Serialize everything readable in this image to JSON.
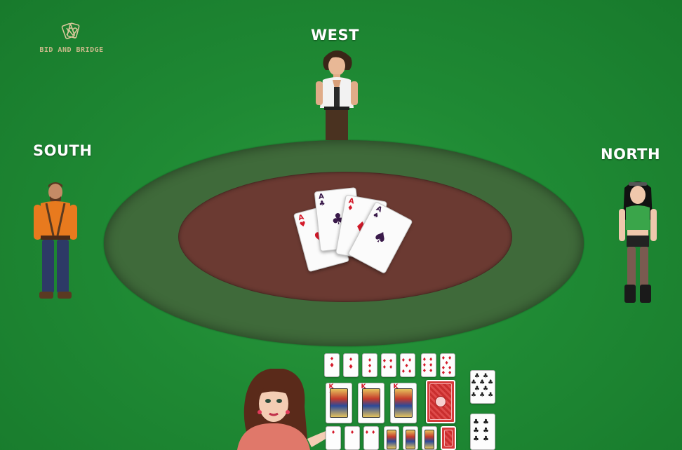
{
  "logo": {
    "text": "BID AND BRIDGE"
  },
  "seats": {
    "west": "WEST",
    "south": "SOUTH",
    "north": "NORTH"
  },
  "trick": [
    {
      "rank": "A",
      "suit": "hearts",
      "glyph": "♥",
      "color": "#d41a2a"
    },
    {
      "rank": "A",
      "suit": "clubs",
      "glyph": "♣",
      "color": "#3a1a4a"
    },
    {
      "rank": "A",
      "suit": "diamonds",
      "glyph": "♦",
      "color": "#d41a2a"
    },
    {
      "rank": "A",
      "suit": "spades",
      "glyph": "♠",
      "color": "#3a1a4a"
    }
  ],
  "hand": {
    "row1": [
      "A♦",
      "A♦",
      "3♦",
      "4♦",
      "5♦",
      "6♦",
      "7♦"
    ],
    "row2": [
      "K",
      "K",
      "K",
      "back"
    ],
    "row3": [
      "2♦",
      "3♦",
      "4♦",
      "J",
      "Q",
      "K",
      "back"
    ],
    "side": [
      "10♣",
      "6♣"
    ]
  },
  "colors": {
    "felt": "#1f8a34",
    "table_outer": "#3f6a3a",
    "table_inner": "#6b3a32",
    "card_back": "#d63a3a"
  }
}
